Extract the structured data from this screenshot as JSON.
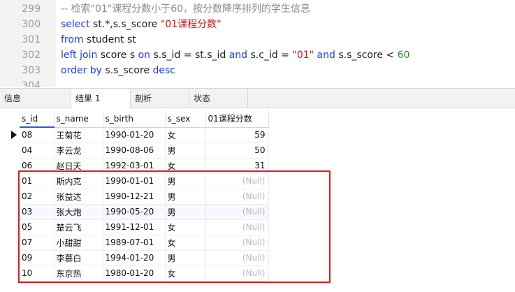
{
  "editor": {
    "lines": [
      {
        "num": "299",
        "tokens": [
          {
            "t": "-- 检索\"01\"课程分数小于60，按分数降序排列的学生信息",
            "c": "cmt"
          }
        ]
      },
      {
        "num": "300",
        "tokens": [
          {
            "t": "select",
            "c": "kw"
          },
          {
            "t": " st.*,s.s_score ",
            "c": ""
          },
          {
            "t": "\"01课程分数\"",
            "c": "str"
          }
        ]
      },
      {
        "num": "301",
        "tokens": [
          {
            "t": "from",
            "c": "kw"
          },
          {
            "t": " student st",
            "c": ""
          }
        ]
      },
      {
        "num": "302",
        "tokens": [
          {
            "t": "left join",
            "c": "kw"
          },
          {
            "t": " score s ",
            "c": ""
          },
          {
            "t": "on",
            "c": "kw"
          },
          {
            "t": " s.s_id = st.s_id ",
            "c": ""
          },
          {
            "t": "and",
            "c": "kw"
          },
          {
            "t": " s.c_id = ",
            "c": ""
          },
          {
            "t": "\"01\"",
            "c": "str"
          },
          {
            "t": " ",
            "c": ""
          },
          {
            "t": "and",
            "c": "kw"
          },
          {
            "t": " s.s_score < ",
            "c": ""
          },
          {
            "t": "60",
            "c": "num"
          }
        ]
      },
      {
        "num": "303",
        "tokens": [
          {
            "t": "order by",
            "c": "kw"
          },
          {
            "t": " s.s_score ",
            "c": ""
          },
          {
            "t": "desc",
            "c": "kw"
          }
        ]
      },
      {
        "num": "304",
        "tokens": []
      }
    ]
  },
  "tabs": [
    {
      "label": "信息",
      "active": false
    },
    {
      "label": "结果 1",
      "active": true
    },
    {
      "label": "剖析",
      "active": false
    },
    {
      "label": "状态",
      "active": false
    }
  ],
  "grid": {
    "columns": [
      "s_id",
      "s_name",
      "s_birth",
      "s_sex",
      "01课程分数"
    ],
    "rows": [
      [
        "08",
        "王菊花",
        "1990-01-20",
        "女",
        "59"
      ],
      [
        "04",
        "李云龙",
        "1990-08-06",
        "男",
        "50"
      ],
      [
        "06",
        "赵日天",
        "1992-03-01",
        "女",
        "31"
      ],
      [
        "01",
        "斯内克",
        "1990-01-01",
        "男",
        "(Null)"
      ],
      [
        "02",
        "张益达",
        "1990-12-21",
        "男",
        "(Null)"
      ],
      [
        "03",
        "张大炮",
        "1990-05-20",
        "男",
        "(Null)"
      ],
      [
        "05",
        "楚云飞",
        "1991-12-01",
        "女",
        "(Null)"
      ],
      [
        "07",
        "小甜甜",
        "1989-07-01",
        "女",
        "(Null)"
      ],
      [
        "09",
        "李慕白",
        "1994-01-20",
        "男",
        "(Null)"
      ],
      [
        "10",
        "东京热",
        "1980-01-20",
        "女",
        "(Null)"
      ]
    ],
    "current_row": 0,
    "null_text": "(Null)"
  },
  "colors": {
    "keyword": "#1a3df0",
    "string": "#d8141b",
    "number": "#1a9a1a",
    "comment": "#8a8a8a",
    "highlight_border": "#d81e1e",
    "null_text": "#b9b9c6"
  }
}
